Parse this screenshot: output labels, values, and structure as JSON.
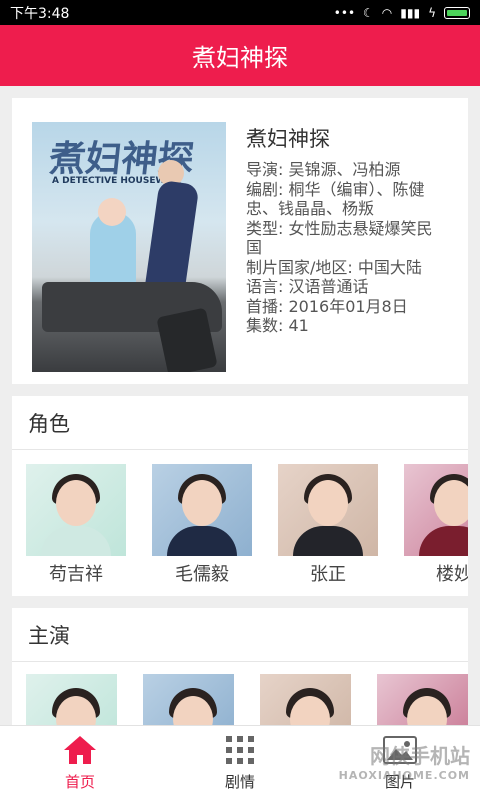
{
  "status_bar": {
    "time": "下午3:48",
    "signal": "..."
  },
  "app_bar": {
    "title": "煮妇神探"
  },
  "poster": {
    "title": "煮妇神探",
    "subtitle": "A DETECTIVE HOUSEWIFE"
  },
  "info": {
    "name": "煮妇神探",
    "director": "导演: 吴锦源、冯柏源",
    "writer": "编剧: 桐华（编审）、陈健忠、钱晶晶、杨叛",
    "genre": "类型: 女性励志悬疑爆笑民国",
    "region": "制片国家/地区: 中国大陆",
    "language": "语言: 汉语普通话",
    "premiere": "首播: 2016年01月8日",
    "episodes": "集数: 41"
  },
  "roles": {
    "heading": "角色",
    "items": [
      {
        "name": "苟吉祥"
      },
      {
        "name": "毛儒毅"
      },
      {
        "name": "张正"
      },
      {
        "name": "楼妙"
      }
    ]
  },
  "cast": {
    "heading": "主演"
  },
  "bottom_nav": {
    "items": [
      {
        "label": "首页",
        "icon": "home-icon",
        "active": true
      },
      {
        "label": "剧情",
        "icon": "grid-icon",
        "active": false
      },
      {
        "label": "图片",
        "icon": "image-icon",
        "active": false
      }
    ]
  },
  "watermark": {
    "text": "网侠手机站",
    "sub": "HAOXIAHOME.COM"
  },
  "colors": {
    "accent": "#ee1d4d",
    "background": "#eeeeee"
  }
}
